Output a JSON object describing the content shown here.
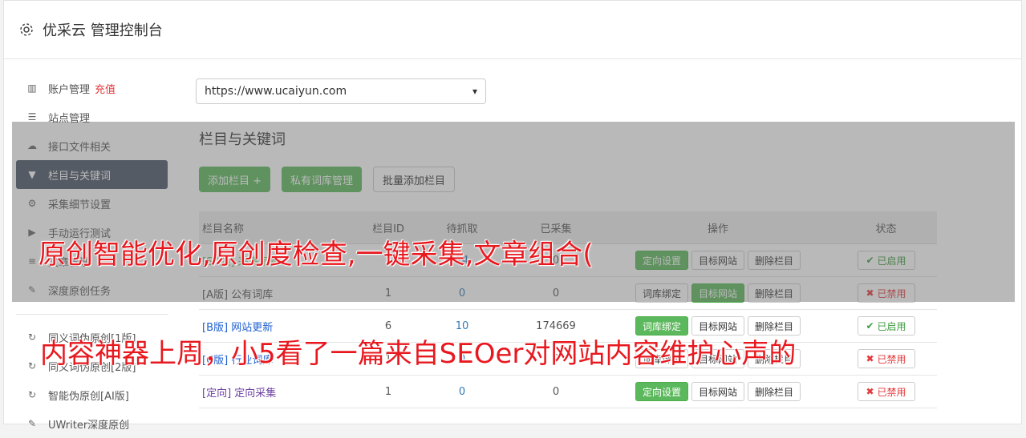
{
  "header": {
    "title": "优采云 管理控制台"
  },
  "sidebar": {
    "items": [
      {
        "label": "账户管理",
        "extra": "充值",
        "icon": "bar-chart-icon"
      },
      {
        "label": "站点管理",
        "icon": "server-icon"
      },
      {
        "label": "接口文件相关",
        "icon": "cloud-icon"
      },
      {
        "label": "栏目与关键词",
        "icon": "filter-icon",
        "active": true
      },
      {
        "label": "采集细节设置",
        "icon": "cogs-icon"
      },
      {
        "label": "手动运行测试",
        "icon": "play-icon"
      },
      {
        "label": "文章管理",
        "icon": "database-icon"
      },
      {
        "label": "深度原创任务",
        "icon": "edit-icon"
      }
    ],
    "items2": [
      {
        "label": "同义词伪原创[1版]",
        "icon": "refresh-icon"
      },
      {
        "label": "同义词伪原创[2版]",
        "icon": "refresh-icon"
      },
      {
        "label": "智能伪原创[AI版]",
        "icon": "refresh-icon"
      },
      {
        "label": "UWriter深度原创",
        "icon": "edit-icon"
      }
    ]
  },
  "site_select": {
    "value": "https://www.ucaiyun.com"
  },
  "main": {
    "section_title": "栏目与关键词",
    "buttons": {
      "add": "添加栏目 +",
      "private": "私有词库管理",
      "batch": "批量添加栏目"
    }
  },
  "table": {
    "headers": [
      "栏目名称",
      "栏目ID",
      "待抓取",
      "已采集",
      "操作",
      "状态"
    ],
    "rows": [
      {
        "tag": "[SA版]",
        "name": "采集示例",
        "id": "1",
        "pending": "14",
        "collected": "0",
        "op1": "定向设置",
        "op2": "目标网站",
        "op3": "删除栏目",
        "status": "已启用",
        "on": true
      },
      {
        "tag": "[A版]",
        "name": "公有词库",
        "id": "1",
        "pending": "0",
        "collected": "0",
        "op1": "词库绑定",
        "op2": "目标网站",
        "op3": "删除栏目",
        "status": "已禁用",
        "on": false
      },
      {
        "tag": "[B版]",
        "name": "网站更新",
        "id": "6",
        "pending": "10",
        "collected": "174669",
        "op1": "词库绑定",
        "op2": "目标网站",
        "op3": "删除栏目",
        "status": "已启用",
        "on": true
      },
      {
        "tag": "[C版]",
        "name": "行业词库",
        "id": "1",
        "pending": "0",
        "collected": "0",
        "op1": "词库绑定",
        "op2": "目标网站",
        "op3": "删除栏目",
        "status": "已禁用",
        "on": false
      },
      {
        "tag": "[定向]",
        "name": "定向采集",
        "id": "1",
        "pending": "0",
        "collected": "0",
        "op1": "定向设置",
        "op2": "目标网站",
        "op3": "删除栏目",
        "status": "已禁用",
        "on": false
      }
    ]
  },
  "captions": {
    "line1": "原创智能优化,原创度检查,一键采集,文章组合(",
    "line2": "内容神器上周，小5看了一篇来自SEOer对网站内容维护心声的"
  },
  "colors": {
    "accent_green": "#5cb85c",
    "active_nav": "#4a5464",
    "caption_red": "#e8181f"
  }
}
